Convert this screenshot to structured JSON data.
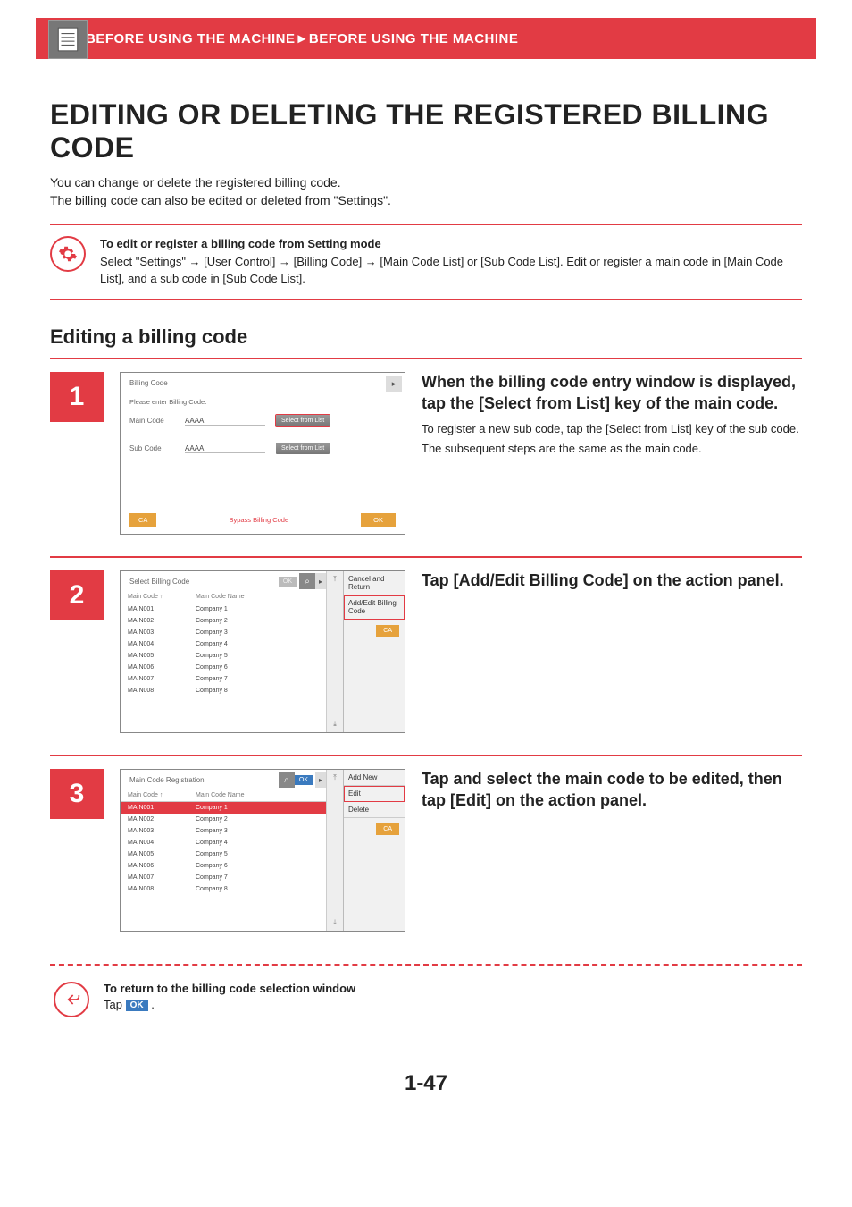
{
  "header": {
    "breadcrumb1": "BEFORE USING THE MACHINE",
    "sep": "►",
    "breadcrumb2": "BEFORE USING THE MACHINE"
  },
  "title": "EDITING OR DELETING THE REGISTERED BILLING CODE",
  "intro": {
    "line1": "You can change or delete the registered billing code.",
    "line2": "The billing code can also be edited or deleted from \"Settings\"."
  },
  "info": {
    "heading": "To edit or register a billing code from Setting mode",
    "body": "Select \"Settings\" → [User Control] → [Billing Code] → [Main Code List] or [Sub Code List]. Edit or register a main code in [Main Code List], and a sub code in [Sub Code List]."
  },
  "section_heading": "Editing a billing code",
  "steps": {
    "s1": {
      "num": "1",
      "heading": "When the billing code entry window is displayed, tap the [Select from List] key of the main code.",
      "p1": "To register a new sub code, tap the [Select from List] key of the sub code.",
      "p2": "The subsequent steps are the same as the main code.",
      "shot": {
        "title": "Billing Code",
        "sub": "Please enter Billing Code.",
        "main_label": "Main Code",
        "main_val": "AAAA",
        "sub_label": "Sub Code",
        "sub_val": "AAAA",
        "select_btn": "Select from List",
        "ca": "CA",
        "bypass": "Bypass Billing Code",
        "ok": "OK"
      }
    },
    "s2": {
      "num": "2",
      "heading": "Tap [Add/Edit Billing Code] on the action panel.",
      "shot": {
        "title": "Select Billing Code",
        "ok": "OK",
        "col1": "Main Code",
        "sort": "↑",
        "col2": "Main Code Name",
        "rows": [
          {
            "c": "MAIN001",
            "n": "Company 1"
          },
          {
            "c": "MAIN002",
            "n": "Company 2"
          },
          {
            "c": "MAIN003",
            "n": "Company 3"
          },
          {
            "c": "MAIN004",
            "n": "Company 4"
          },
          {
            "c": "MAIN005",
            "n": "Company 5"
          },
          {
            "c": "MAIN006",
            "n": "Company 6"
          },
          {
            "c": "MAIN007",
            "n": "Company 7"
          },
          {
            "c": "MAIN008",
            "n": "Company 8"
          }
        ],
        "ap": {
          "cancel": "Cancel and Return",
          "addedit": "Add/Edit Billing Code",
          "ca": "CA"
        }
      }
    },
    "s3": {
      "num": "3",
      "heading": "Tap and select the main code to be edited, then tap [Edit] on the action panel.",
      "shot": {
        "title": "Main Code Registration",
        "ok": "OK",
        "col1": "Main Code",
        "sort": "↑",
        "col2": "Main Code Name",
        "rows": [
          {
            "c": "MAIN001",
            "n": "Company 1",
            "sel": true
          },
          {
            "c": "MAIN002",
            "n": "Company 2"
          },
          {
            "c": "MAIN003",
            "n": "Company 3"
          },
          {
            "c": "MAIN004",
            "n": "Company 4"
          },
          {
            "c": "MAIN005",
            "n": "Company 5"
          },
          {
            "c": "MAIN006",
            "n": "Company 6"
          },
          {
            "c": "MAIN007",
            "n": "Company 7"
          },
          {
            "c": "MAIN008",
            "n": "Company 8"
          }
        ],
        "ap": {
          "addnew": "Add New",
          "edit": "Edit",
          "delete": "Delete",
          "ca": "CA"
        }
      }
    }
  },
  "return": {
    "heading": "To return to the billing code selection window",
    "tap_prefix": "Tap ",
    "ok_chip": "OK",
    "tap_suffix": " ."
  },
  "page_number": "1-47"
}
